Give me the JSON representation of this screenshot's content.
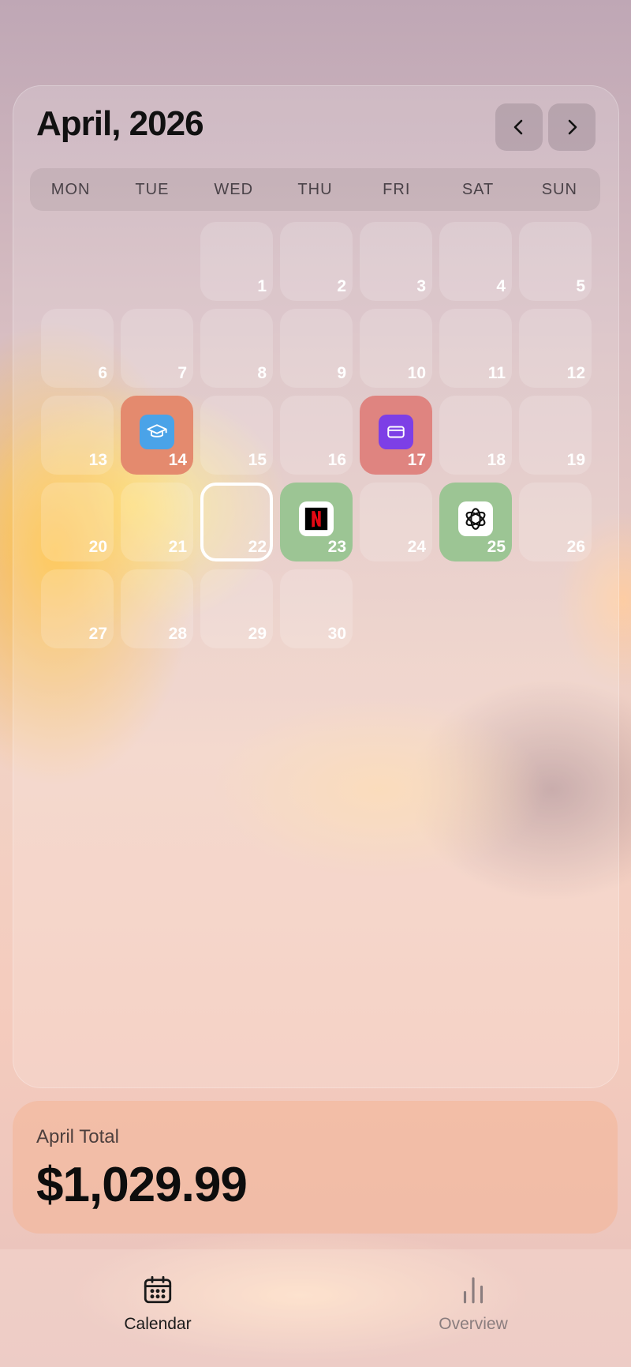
{
  "header": {
    "month_title": "April, 2026",
    "prev_icon": "chevron-left-icon",
    "next_icon": "chevron-right-icon"
  },
  "weekdays": [
    "MON",
    "TUE",
    "WED",
    "THU",
    "FRI",
    "SAT",
    "SUN"
  ],
  "days": [
    "1",
    "2",
    "3",
    "4",
    "5",
    "6",
    "7",
    "8",
    "9",
    "10",
    "11",
    "12",
    "13",
    "14",
    "15",
    "16",
    "17",
    "18",
    "19",
    "20",
    "21",
    "22",
    "23",
    "24",
    "25",
    "26",
    "27",
    "28",
    "29",
    "30"
  ],
  "events": [
    {
      "day": "14",
      "icon": "graduation-cap-icon",
      "tile_color": "#e48a6e",
      "icon_bg": "#4aa3e8"
    },
    {
      "day": "17",
      "icon": "credit-card-icon",
      "tile_color": "#df8480",
      "icon_bg": "#7d3fe6"
    },
    {
      "day": "23",
      "icon": "netflix-logo-icon",
      "tile_color": "#9cc594",
      "icon_bg": "#ffffff"
    },
    {
      "day": "25",
      "icon": "openai-logo-icon",
      "tile_color": "#9cc594",
      "icon_bg": "#ffffff"
    }
  ],
  "today": "22",
  "summary": {
    "label": "April Total",
    "value": "$1,029.99"
  },
  "tabs": [
    {
      "label": "Calendar",
      "icon": "calendar-icon",
      "active": true
    },
    {
      "label": "Overview",
      "icon": "bar-chart-icon",
      "active": false
    }
  ],
  "colors": {
    "active_tab": "#1a1a1a",
    "inactive_tab": "#8a7d7e"
  }
}
